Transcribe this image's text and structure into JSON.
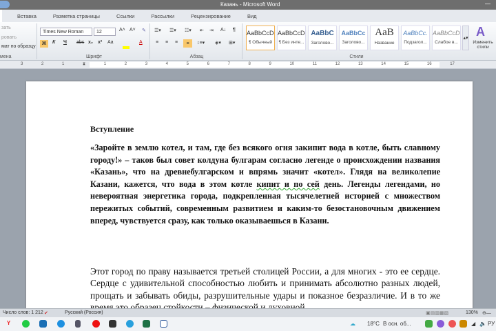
{
  "window": {
    "title": "Казань - Microsoft Word"
  },
  "tabs": [
    "Вставка",
    "Разметка страницы",
    "Ссылки",
    "Рассылки",
    "Рецензирование",
    "Вид"
  ],
  "clipboard": {
    "cut": "зать",
    "copy": "ровать",
    "format_painter": "мат по образцу",
    "label": "мена"
  },
  "font": {
    "name": "Times New Roman",
    "size": "12",
    "label": "Шрифт",
    "bold": "Ж",
    "italic": "К",
    "underline": "Ч",
    "strike": "abc",
    "sub": "x₂",
    "sup": "x²",
    "case": "Aa",
    "grow": "A˄",
    "shrink": "A˅",
    "color": "A"
  },
  "paragraph": {
    "label": "Абзац",
    "pilcrow": "¶"
  },
  "styles": {
    "label": "Стили",
    "items": [
      {
        "sample": "AaBbCcDc",
        "name": "¶ Обычный"
      },
      {
        "sample": "AaBbCcDc",
        "name": "¶ Без инте..."
      },
      {
        "sample": "AaBbC",
        "name": "Заголово..."
      },
      {
        "sample": "AaBbCc",
        "name": "Заголово..."
      },
      {
        "sample": "AaB",
        "name": "Название"
      },
      {
        "sample": "AaBbCc.",
        "name": "Подзагол..."
      },
      {
        "sample": "AaBbCcDt",
        "name": "Слабое в..."
      }
    ],
    "change": "Изменить стили"
  },
  "ruler": [
    "3",
    "2",
    "1",
    "",
    "1",
    "2",
    "3",
    "4",
    "5",
    "6",
    "7",
    "8",
    "9",
    "10",
    "11",
    "12",
    "13",
    "14",
    "15",
    "16",
    "17"
  ],
  "document": {
    "heading": "Вступление",
    "p1_a": "«Заройте в землю котел, и там, где без всякого огня закипит вода в котле, быть славному городу!» – таков был совет колдуна булгарам согласно легенде о происхождении названия «Казань», что на древнебулгарском и впрямь значит «котел». Глядя на великолепие Казани, кажется, что вода в этом котле ",
    "p1_err": "кипит и по сей",
    "p1_b": " день. Легенды легендами, но невероятная энергетика города, подкрепленная тысячелетней историей с множеством пережитых событий, современным развитием и каким-то безостановочным движением вперед, чувствуется сразу, как только оказываешься в Казани.",
    "p2": "Этот город по праву называется третьей столицей России, а для многих - это ее сердце. Сердце с удивительной способностью любить и принимать абсолютно разных людей, прощать и забывать обиды, разрушительные удары и показное безразличие. И в то же время это образец стойкости – физической и духовной."
  },
  "status": {
    "words": "Число слов: 1 212",
    "language": "Русский (Россия)",
    "zoom": "130%"
  },
  "taskbar": {
    "weather": "18°C",
    "weather_text": "В осн. об...",
    "lang": "РУ"
  }
}
